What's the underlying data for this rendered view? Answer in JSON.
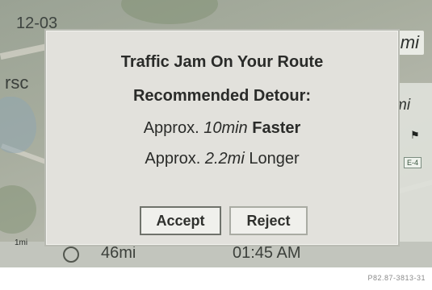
{
  "map": {
    "top_time": "12-03",
    "top_right_distance": "mi",
    "left_label": "rsc",
    "right_distance": "mi",
    "right_badge": "E-4",
    "bottom_distance": "46mi",
    "bottom_time": "01:45 AM",
    "scale_label": "1mi"
  },
  "dialog": {
    "line1": "Traffic Jam On Your Route",
    "line2": "Recommended Detour:",
    "line3_prefix": "Approx.",
    "line3_value": "10min",
    "line3_suffix": "Faster",
    "line4_prefix": "Approx.",
    "line4_value": "2.2mi",
    "line4_suffix": "Longer",
    "accept_label": "Accept",
    "reject_label": "Reject"
  },
  "caption": "P82.87-3813-31",
  "colors": {
    "dialog_bg": "#e2e1dc",
    "button_bg": "#f0f0ec",
    "text": "#2a2b29"
  }
}
